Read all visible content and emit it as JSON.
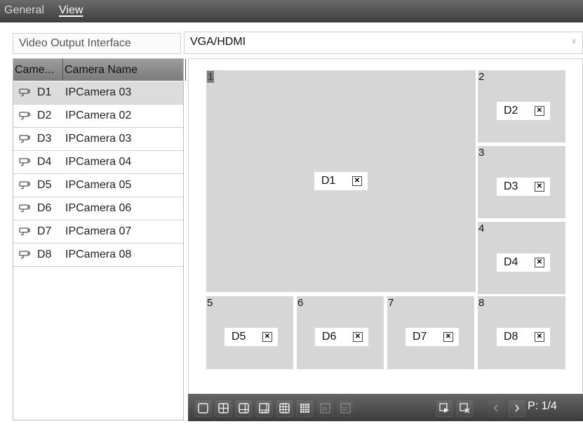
{
  "tabs": [
    {
      "label": "General",
      "active": false
    },
    {
      "label": "View",
      "active": true
    }
  ],
  "video_output": {
    "label": "Video Output Interface",
    "value": "VGA/HDMI"
  },
  "camera_list": {
    "headers": [
      "Came...",
      "Camera Name"
    ],
    "rows": [
      {
        "id": "D1",
        "name": "IPCamera 03",
        "selected": true
      },
      {
        "id": "D2",
        "name": "IPCamera 02"
      },
      {
        "id": "D3",
        "name": "IPCamera 03"
      },
      {
        "id": "D4",
        "name": "IPCamera 04"
      },
      {
        "id": "D5",
        "name": "IPCamera 05"
      },
      {
        "id": "D6",
        "name": "IPCamera 06"
      },
      {
        "id": "D7",
        "name": "IPCamera 07"
      },
      {
        "id": "D8",
        "name": "IPCamera 08"
      }
    ]
  },
  "layout_tiles": [
    {
      "number": "1",
      "camera": "D1"
    },
    {
      "number": "2",
      "camera": "D2"
    },
    {
      "number": "3",
      "camera": "D3"
    },
    {
      "number": "4",
      "camera": "D4"
    },
    {
      "number": "5",
      "camera": "D5"
    },
    {
      "number": "6",
      "camera": "D6"
    },
    {
      "number": "7",
      "camera": "D7"
    },
    {
      "number": "8",
      "camera": "D8"
    }
  ],
  "toolbar": {
    "buttons": [
      {
        "icon": "layout-1-icon",
        "enabled": true
      },
      {
        "icon": "layout-4-icon",
        "enabled": true
      },
      {
        "icon": "layout-6-icon",
        "enabled": true
      },
      {
        "icon": "layout-8-icon",
        "enabled": true
      },
      {
        "icon": "layout-9-icon",
        "enabled": true
      },
      {
        "icon": "layout-16-icon",
        "enabled": true
      },
      {
        "icon": "layout-25-icon",
        "enabled": false
      },
      {
        "icon": "layout-32-icon",
        "enabled": false
      },
      {
        "icon": "start-live-view-icon",
        "enabled": true
      },
      {
        "icon": "stop-live-view-icon",
        "enabled": true
      },
      {
        "icon": "previous-page-icon",
        "enabled": false
      },
      {
        "icon": "next-page-icon",
        "enabled": true
      }
    ],
    "page_indicator": "P: 1/4"
  }
}
